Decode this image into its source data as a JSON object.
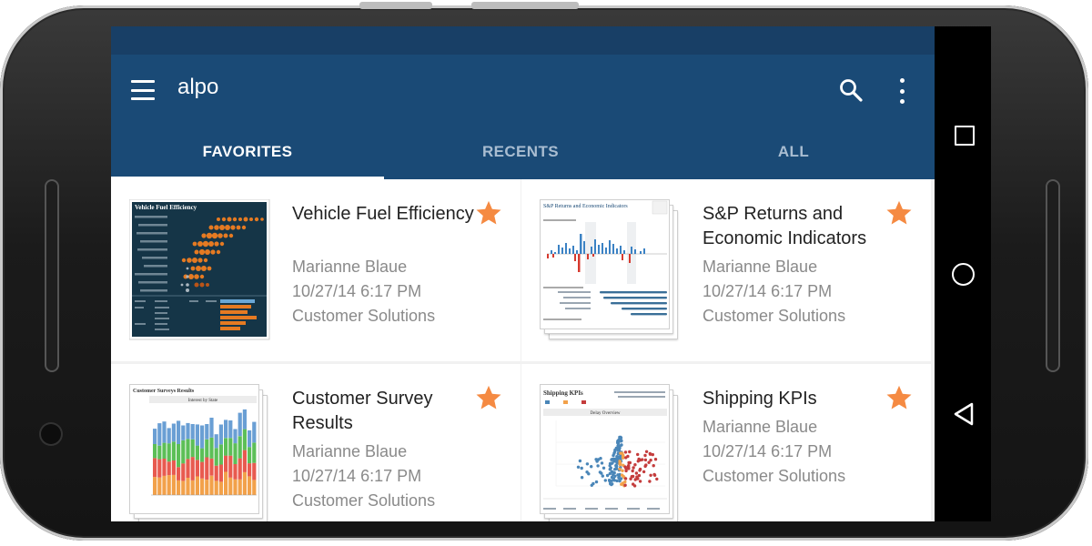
{
  "app": {
    "title": "alpo"
  },
  "toolbar": {
    "menu_icon": "menu-icon",
    "search_icon": "search-icon",
    "more_icon": "more-vert-icon"
  },
  "tabs": [
    {
      "label": "FAVORITES",
      "active": true
    },
    {
      "label": "RECENTS",
      "active": false
    },
    {
      "label": "ALL",
      "active": false
    }
  ],
  "workbooks": [
    {
      "title": "Vehicle Fuel Efficiency",
      "author": "Marianne Blaue",
      "modified": "10/27/14 6:17 PM",
      "site": "Customer Solutions",
      "favorite": true,
      "thumbnail": {
        "heading": "Vehicle Fuel Efficiency"
      }
    },
    {
      "title": "S&P Returns and Economic Indicators",
      "author": "Marianne Blaue",
      "modified": "10/27/14 6:17 PM",
      "site": "Customer Solutions",
      "favorite": true,
      "thumbnail": {
        "heading": "S&P Returns and Economic Indicators"
      }
    },
    {
      "title": "Customer Survey Results",
      "author": "Marianne Blaue",
      "modified": "10/27/14 6:17 PM",
      "site": "Customer Solutions",
      "favorite": true,
      "thumbnail": {
        "heading": "Customer Surveys Results",
        "subheading": "Interest by State"
      }
    },
    {
      "title": "Shipping KPIs",
      "author": "Marianne Blaue",
      "modified": "10/27/14 6:17 PM",
      "site": "Customer Solutions",
      "favorite": true,
      "thumbnail": {
        "heading": "Shipping KPIs",
        "subheading": "Delay Overview"
      }
    }
  ],
  "android_nav": {
    "recents_icon": "square-icon",
    "home_icon": "circle-icon",
    "back_icon": "triangle-back-icon"
  },
  "colors": {
    "status_bar": "#183f66",
    "app_bar": "#1a4a76",
    "star": "#f58a42",
    "meta_text": "#8a8a8a"
  }
}
